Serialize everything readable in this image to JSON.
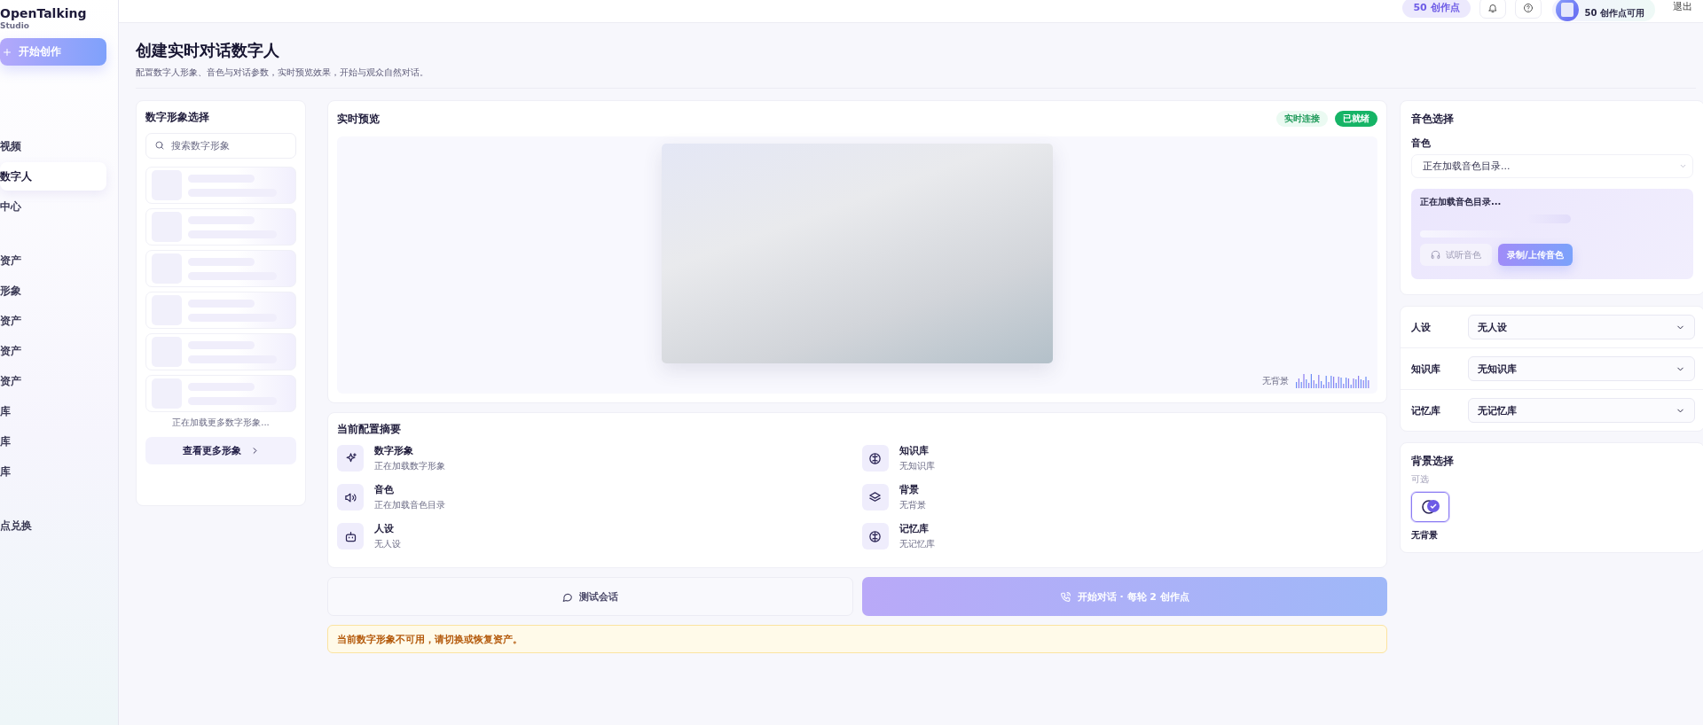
{
  "brand": {
    "name": "OpenTalking",
    "subtitle": "Studio"
  },
  "create_button": {
    "label": "开始创作"
  },
  "sidebar": {
    "groups": [
      {
        "items": [
          {
            "label": "视频",
            "selected": false
          },
          {
            "label": "数字人",
            "selected": true
          },
          {
            "label": "中心",
            "selected": false
          }
        ]
      },
      {
        "items": [
          {
            "label": "资产",
            "selected": false
          },
          {
            "label": "形象",
            "selected": false
          },
          {
            "label": "资产",
            "selected": false
          },
          {
            "label": "资产",
            "selected": false
          },
          {
            "label": "资产",
            "selected": false
          },
          {
            "label": "库",
            "selected": false
          },
          {
            "label": "库",
            "selected": false
          },
          {
            "label": "库",
            "selected": false
          }
        ]
      },
      {
        "items": [
          {
            "label": "点兑换",
            "selected": false
          }
        ]
      }
    ]
  },
  "top_bar": {
    "credits": "50 创作点",
    "account": "50 创作点可用",
    "logout": "退出"
  },
  "page": {
    "title": "创建实时对话数字人",
    "subtitle": "配置数字人形象、音色与对话参数，实时预览效果，开始与观众自然对话。"
  },
  "avatar_panel": {
    "title": "数字形象选择",
    "search_placeholder": "搜索数字形象",
    "cards": [
      {
        "kind": "skeleton"
      },
      {
        "kind": "skeleton"
      },
      {
        "kind": "skeleton"
      },
      {
        "kind": "skeleton"
      },
      {
        "kind": "skeleton"
      },
      {
        "kind": "skeleton"
      }
    ],
    "loading_text": "正在加载更多数字形象...",
    "more_button": "查看更多形象"
  },
  "preview": {
    "title": "实时预览",
    "badges": [
      {
        "label": "实时连接",
        "kind": "soft"
      },
      {
        "label": "已就绪",
        "kind": "solid"
      }
    ],
    "background_label": "无背景"
  },
  "summary": {
    "title": "当前配置摘要",
    "items": [
      {
        "kind": "avatar",
        "label": "数字形象",
        "value": "正在加载数字形象"
      },
      {
        "kind": "knowledge",
        "label": "知识库",
        "value": "无知识库"
      },
      {
        "kind": "voice",
        "label": "音色",
        "value": "正在加载音色目录"
      },
      {
        "kind": "background",
        "label": "背景",
        "value": "无背景"
      },
      {
        "kind": "persona",
        "label": "人设",
        "value": "无人设"
      },
      {
        "kind": "memory",
        "label": "记忆库",
        "value": "无记忆库"
      }
    ]
  },
  "actions": [
    {
      "kind": "test",
      "label": "测试会话",
      "disabled": false
    },
    {
      "kind": "start",
      "label": "开始对话 · 每轮 2 创作点",
      "disabled": true
    }
  ],
  "warning": "当前数字形象不可用，请切换或恢复资产。",
  "voice": {
    "title": "音色选择",
    "field_label": "音色",
    "select_value": "正在加载音色目录...",
    "status_title": "正在加载音色目录...",
    "preview_button": {
      "label": "试听音色",
      "disabled": true
    },
    "record_button": "录制/上传音色"
  },
  "settings": [
    {
      "label": "人设",
      "value": "无人设"
    },
    {
      "label": "知识库",
      "value": "无知识库"
    },
    {
      "label": "记忆库",
      "value": "无记忆库"
    }
  ],
  "background": {
    "title": "背景选择",
    "hint": "可选",
    "options": [
      {
        "label": "无背景",
        "selected": true
      }
    ]
  }
}
